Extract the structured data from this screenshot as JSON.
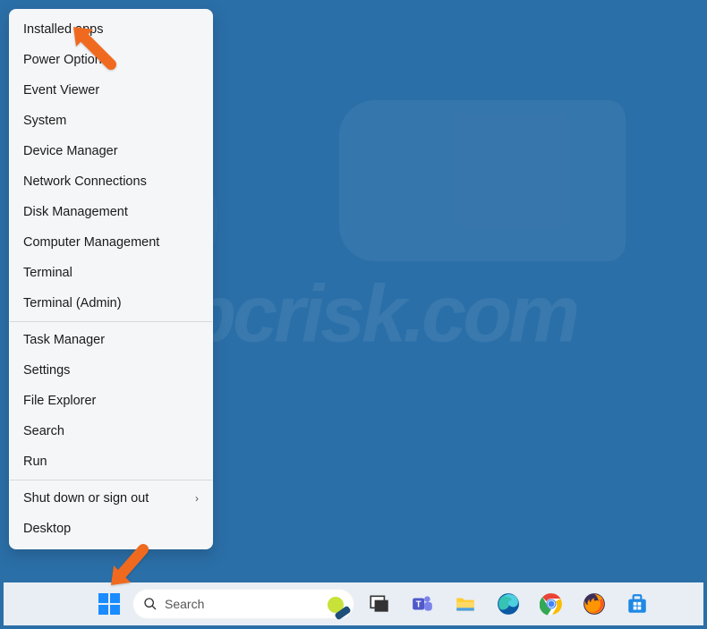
{
  "context_menu": {
    "groups": [
      [
        {
          "label": "Installed apps",
          "submenu": false
        },
        {
          "label": "Power Options",
          "submenu": false
        },
        {
          "label": "Event Viewer",
          "submenu": false
        },
        {
          "label": "System",
          "submenu": false
        },
        {
          "label": "Device Manager",
          "submenu": false
        },
        {
          "label": "Network Connections",
          "submenu": false
        },
        {
          "label": "Disk Management",
          "submenu": false
        },
        {
          "label": "Computer Management",
          "submenu": false
        },
        {
          "label": "Terminal",
          "submenu": false
        },
        {
          "label": "Terminal (Admin)",
          "submenu": false
        }
      ],
      [
        {
          "label": "Task Manager",
          "submenu": false
        },
        {
          "label": "Settings",
          "submenu": false
        },
        {
          "label": "File Explorer",
          "submenu": false
        },
        {
          "label": "Search",
          "submenu": false
        },
        {
          "label": "Run",
          "submenu": false
        }
      ],
      [
        {
          "label": "Shut down or sign out",
          "submenu": true
        },
        {
          "label": "Desktop",
          "submenu": false
        }
      ]
    ]
  },
  "taskbar": {
    "search_placeholder": "Search",
    "icons": [
      {
        "name": "start-button"
      },
      {
        "name": "task-view"
      },
      {
        "name": "teams"
      },
      {
        "name": "file-explorer"
      },
      {
        "name": "edge"
      },
      {
        "name": "chrome"
      },
      {
        "name": "firefox"
      },
      {
        "name": "microsoft-store"
      }
    ]
  },
  "watermark_text": "pcrisk.com",
  "annotation_arrows": [
    {
      "target": "menu-item-installed-apps"
    },
    {
      "target": "start-button"
    }
  ],
  "colors": {
    "desktop_bg": "#2b6fa8",
    "menu_bg": "#f5f6f8",
    "taskbar_bg": "#e8eef4",
    "arrow": "#ef6a1f",
    "win_logo": "#1a8cff"
  }
}
